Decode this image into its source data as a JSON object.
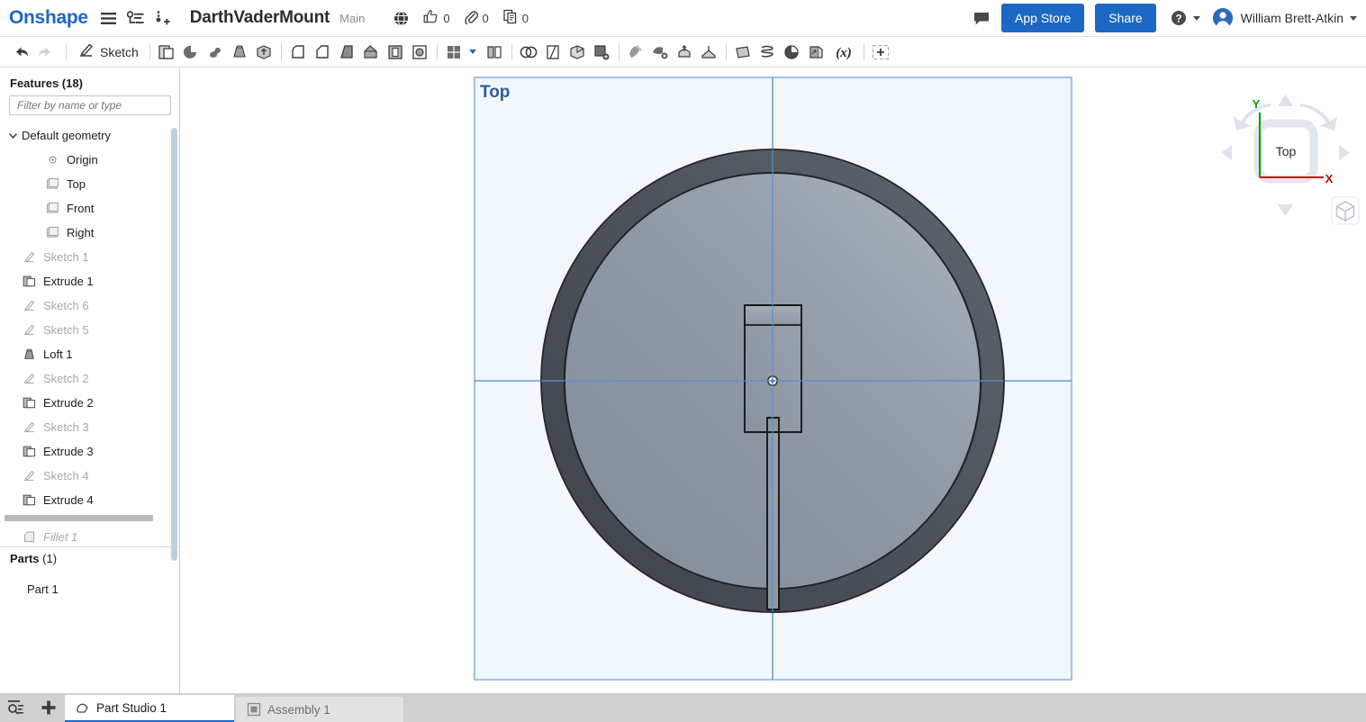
{
  "header": {
    "logo": "Onshape",
    "menu_icon": "hamburger-menu-icon",
    "versions_icon": "version-graph-icon",
    "add_version_icon": "add-version-icon",
    "document_title": "DarthVaderMount",
    "branch": "Main",
    "globe_icon": "globe-public-icon",
    "like_icon": "thumbs-up-icon",
    "like_count": "0",
    "link_icon": "paperclip-icon",
    "link_count": "0",
    "copy_icon": "copy-document-icon",
    "copy_count": "0",
    "comment_icon": "comment-bubble-icon",
    "app_store_label": "App Store",
    "share_label": "Share",
    "help_icon": "help-question-icon",
    "user_name": "William Brett-Atkin",
    "avatar_icon": "user-avatar",
    "accent_color": "#1d68c4"
  },
  "toolbar": {
    "undo_icon": "undo-arrow-icon",
    "redo_icon": "redo-arrow-icon",
    "sketch_label": "Sketch",
    "sketch_icon": "sketch-pencil-icon",
    "items": [
      {
        "name": "extrude-icon",
        "title": "Extrude"
      },
      {
        "name": "revolve-icon",
        "title": "Revolve"
      },
      {
        "name": "sweep-icon",
        "title": "Sweep"
      },
      {
        "name": "loft-icon",
        "title": "Loft"
      },
      {
        "name": "thicken-icon",
        "title": "Thicken"
      },
      {
        "name": "fillet-icon",
        "title": "Fillet"
      },
      {
        "name": "chamfer-icon",
        "title": "Chamfer"
      },
      {
        "name": "draft-icon",
        "title": "Draft"
      },
      {
        "name": "rib-icon",
        "title": "Rib"
      },
      {
        "name": "shell-icon",
        "title": "Shell"
      },
      {
        "name": "hole-icon",
        "title": "Hole"
      },
      {
        "name": "pattern-icon",
        "title": "Pattern"
      },
      {
        "name": "mirror-icon",
        "title": "Mirror"
      },
      {
        "name": "boolean-icon",
        "title": "Boolean"
      },
      {
        "name": "split-icon",
        "title": "Split"
      },
      {
        "name": "delete-face-icon",
        "title": "Delete face"
      },
      {
        "name": "move-face-icon",
        "title": "Move face"
      },
      {
        "name": "delete-part-icon",
        "title": "Delete part"
      },
      {
        "name": "transform-icon",
        "title": "Transform"
      },
      {
        "name": "replace-face-icon",
        "title": "Replace face"
      },
      {
        "name": "plane-icon",
        "title": "Plane"
      },
      {
        "name": "helix-icon",
        "title": "Helix"
      },
      {
        "name": "curve-icon",
        "title": "Curve"
      },
      {
        "name": "derived-icon",
        "title": "Derived"
      },
      {
        "name": "variable-icon",
        "title": "Variable"
      },
      {
        "name": "more-tools-icon",
        "title": "More"
      }
    ]
  },
  "sidebar": {
    "features_title": "Features (18)",
    "filter_placeholder": "Filter by name or type",
    "tree": [
      {
        "label": "Default geometry",
        "icon": "folder-icon",
        "state": "normal",
        "indent": 0,
        "chevron": true
      },
      {
        "label": "Origin",
        "icon": "origin-icon",
        "state": "normal",
        "indent": 2,
        "chevron": false
      },
      {
        "label": "Top",
        "icon": "plane-icon",
        "state": "normal",
        "indent": 2,
        "chevron": false
      },
      {
        "label": "Front",
        "icon": "plane-icon",
        "state": "normal",
        "indent": 2,
        "chevron": false
      },
      {
        "label": "Right",
        "icon": "plane-icon",
        "state": "normal",
        "indent": 2,
        "chevron": false
      },
      {
        "label": "Sketch 1",
        "icon": "sketch-icon",
        "state": "dim",
        "indent": 0,
        "chevron": false
      },
      {
        "label": "Extrude 1",
        "icon": "extrude-icon",
        "state": "normal",
        "indent": 0,
        "chevron": false
      },
      {
        "label": "Sketch 6",
        "icon": "sketch-icon",
        "state": "dim",
        "indent": 0,
        "chevron": false
      },
      {
        "label": "Sketch 5",
        "icon": "sketch-icon",
        "state": "dim",
        "indent": 0,
        "chevron": false
      },
      {
        "label": "Loft 1",
        "icon": "loft-icon",
        "state": "normal",
        "indent": 0,
        "chevron": false
      },
      {
        "label": "Sketch 2",
        "icon": "sketch-icon",
        "state": "dim",
        "indent": 0,
        "chevron": false
      },
      {
        "label": "Extrude 2",
        "icon": "extrude-icon",
        "state": "normal",
        "indent": 0,
        "chevron": false
      },
      {
        "label": "Sketch 3",
        "icon": "sketch-icon",
        "state": "dim",
        "indent": 0,
        "chevron": false
      },
      {
        "label": "Extrude 3",
        "icon": "extrude-icon",
        "state": "normal",
        "indent": 0,
        "chevron": false
      },
      {
        "label": "Sketch 4",
        "icon": "sketch-icon",
        "state": "dim",
        "indent": 0,
        "chevron": false
      },
      {
        "label": "Extrude 4",
        "icon": "extrude-icon",
        "state": "normal",
        "indent": 0,
        "chevron": false
      }
    ],
    "rollback_feature": {
      "label": "Fillet 1",
      "icon": "fillet-icon",
      "state": "italic-dim"
    },
    "parts_title_bold": "Parts",
    "parts_title_count": " (1)",
    "parts": [
      {
        "label": "Part 1"
      }
    ]
  },
  "viewport": {
    "plane_label": "Top",
    "plane_label_color": "#2c5d9b",
    "plane_fill": "#f2f7fb",
    "plane_border": "#a8c4e0",
    "axis_line_color": "#6d9bd1",
    "part_rim_color": "#474c54",
    "part_face_color": "#8a93a0",
    "part_edge_color": "#1a1a1a",
    "background": "#ffffff"
  },
  "navcube": {
    "face_label": "Top",
    "axis_x_label": "X",
    "axis_y_label": "Y",
    "axis_x_color": "#cc0000",
    "axis_y_color": "#00a000",
    "arrow_color": "#dde3ea",
    "cube_icon": "view-cube-icon",
    "rotate_left_icon": "rotate-left-arrow-icon",
    "rotate_right_icon": "rotate-right-arrow-icon",
    "nav_up_icon": "nav-up-triangle-icon",
    "nav_down_icon": "nav-down-triangle-icon",
    "nav_left_icon": "nav-left-triangle-icon",
    "nav_right_icon": "nav-right-triangle-icon"
  },
  "bottom": {
    "search_icon": "search-list-icon",
    "add_icon": "add-tab-plus-icon",
    "tabs": [
      {
        "label": "Part Studio 1",
        "icon": "part-studio-icon",
        "active": true
      },
      {
        "label": "Assembly 1",
        "icon": "assembly-icon",
        "active": false
      }
    ]
  }
}
